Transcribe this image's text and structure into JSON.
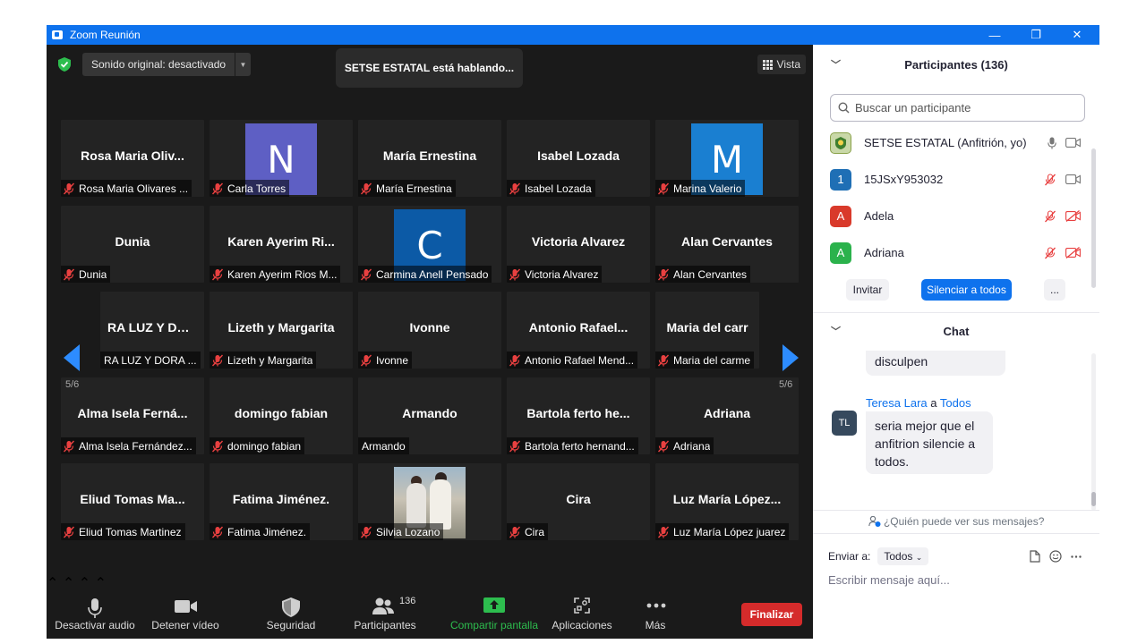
{
  "window": {
    "title": "Zoom Reunión",
    "controls": {
      "minimize": "—",
      "restore": "❐",
      "close": "✕"
    }
  },
  "top": {
    "sound_label": "Sonido original: desactivado",
    "speaking": "SETSE ESTATAL está hablando...",
    "view_label": "Vista"
  },
  "nav": {
    "left_page": "5/6",
    "right_page": "5/6"
  },
  "tiles": [
    {
      "big": "Rosa Maria Oliv...",
      "label": "Rosa Maria Olivares ...",
      "muted": true
    },
    {
      "avatar": "N",
      "avatar_color": "#5e5fc4",
      "label": "Carla Torres",
      "muted": true
    },
    {
      "big": "María Ernestina",
      "label": "María Ernestina",
      "muted": true
    },
    {
      "big": "Isabel  Lozada",
      "label": "Isabel  Lozada",
      "muted": true
    },
    {
      "avatar": "M",
      "avatar_color": "#1a7fd1",
      "label": "Marina Valerio",
      "muted": true
    },
    {
      "big": "Dunia",
      "label": "Dunia",
      "muted": true
    },
    {
      "big": "Karen Ayerim Ri...",
      "label": "Karen Ayerim Rios M...",
      "muted": true
    },
    {
      "avatar": "C",
      "avatar_color": "#0c5aa6",
      "label": "Carmina Anell Pensado",
      "muted": true
    },
    {
      "big": "Victoria Alvarez",
      "label": "Victoria Alvarez",
      "muted": true
    },
    {
      "big": "Alan Cervantes",
      "label": "Alan Cervantes",
      "muted": true
    },
    {
      "big": "RA LUZ Y DO...",
      "label": "RA LUZ Y DORA ...",
      "muted": false
    },
    {
      "big": "Lizeth y Margarita",
      "label": "Lizeth y Margarita",
      "muted": true
    },
    {
      "big": "Ivonne",
      "label": "Ivonne",
      "muted": true
    },
    {
      "big": "Antonio  Rafael...",
      "label": "Antonio Rafael Mend...",
      "muted": true
    },
    {
      "big": "Maria del carr",
      "label": "Maria del carme",
      "muted": true
    },
    {
      "big": "Alma Isela Ferná...",
      "label": "Alma Isela Fernández...",
      "muted": true
    },
    {
      "big": "domingo fabian",
      "label": "domingo fabian",
      "muted": true
    },
    {
      "big": "Armando",
      "label": "Armando",
      "muted": false
    },
    {
      "big": "Bartola ferto he...",
      "label": "Bartola ferto hernand...",
      "muted": true
    },
    {
      "big": "Adriana",
      "label": "Adriana",
      "muted": true
    },
    {
      "big": "Eliud Tomas Ma...",
      "label": "Eliud Tomas Martinez",
      "muted": true
    },
    {
      "big": "Fatima Jiménez.",
      "label": "Fatima Jiménez.",
      "muted": true
    },
    {
      "photo": true,
      "label": "Silvia Lozano",
      "muted": true
    },
    {
      "big": "Cira",
      "label": "Cira",
      "muted": true
    },
    {
      "big": "Luz María López...",
      "label": "Luz María López juarez",
      "muted": true
    }
  ],
  "toolbar": {
    "mute": "Desactivar audio",
    "video": "Detener vídeo",
    "security": "Seguridad",
    "participants": "Participantes",
    "participants_count": "136",
    "share": "Compartir pantalla",
    "apps": "Aplicaciones",
    "more": "Más",
    "end": "Finalizar"
  },
  "participants_panel": {
    "title": "Participantes (136)",
    "search_placeholder": "Buscar un participante",
    "list": [
      {
        "name": "SETSE ESTATAL (Anfitrión, yo)",
        "avatar": "",
        "avatar_color": "#c9d8a8",
        "mic_on": true
      },
      {
        "name": "15JSxY953032",
        "avatar": "1",
        "avatar_color": "#1f6fb5",
        "mic_on": false
      },
      {
        "name": "Adela",
        "avatar": "A",
        "avatar_color": "#d93a2b",
        "mic_on": false
      },
      {
        "name": "Adriana",
        "avatar": "A",
        "avatar_color": "#2bb24c",
        "mic_on": false
      }
    ],
    "invite": "Invitar",
    "mute_all": "Silenciar a todos",
    "more": "..."
  },
  "chat": {
    "title": "Chat",
    "prev_message": "disculpen",
    "sender": "Teresa Lara",
    "to_word": "a",
    "recipient": "Todos",
    "avatar": "TL",
    "message_lines": [
      "seria mejor que el",
      "anfitrion silencie a",
      "todos."
    ],
    "who_sees": "¿Quién puede ver sus mensajes?",
    "send_to_label": "Enviar a:",
    "send_to_value": "Todos",
    "input_placeholder": "Escribir mensaje aquí..."
  }
}
